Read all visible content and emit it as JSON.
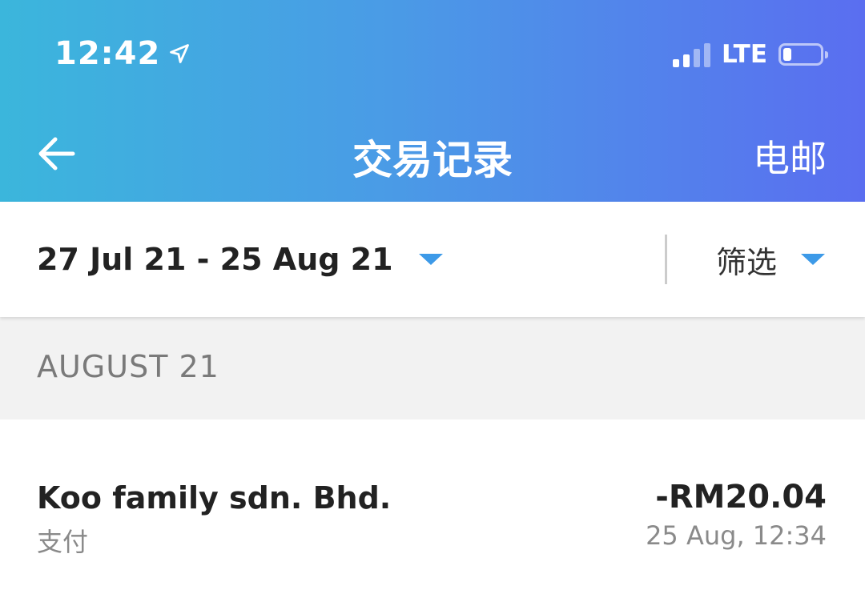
{
  "status_bar": {
    "time": "12:42",
    "network": "LTE",
    "location_icon": "location-arrow-icon",
    "signal_icon": "signal-bars-icon",
    "battery_icon": "battery-low-icon"
  },
  "header": {
    "title": "交易记录",
    "back_icon": "arrow-left-icon",
    "email_label": "电邮",
    "gradient_start": "#3bb6dc",
    "gradient_end": "#5a6ef0"
  },
  "filter_bar": {
    "date_range": "27 Jul 21 - 25 Aug 21",
    "filter_label": "筛选",
    "accent_color": "#3d9ae8"
  },
  "sections": [
    {
      "label": "AUGUST 21",
      "transactions": [
        {
          "merchant": "Koo family sdn. Bhd.",
          "type": "支付",
          "amount": "-RM20.04",
          "datetime": "25 Aug, 12:34"
        }
      ]
    }
  ]
}
